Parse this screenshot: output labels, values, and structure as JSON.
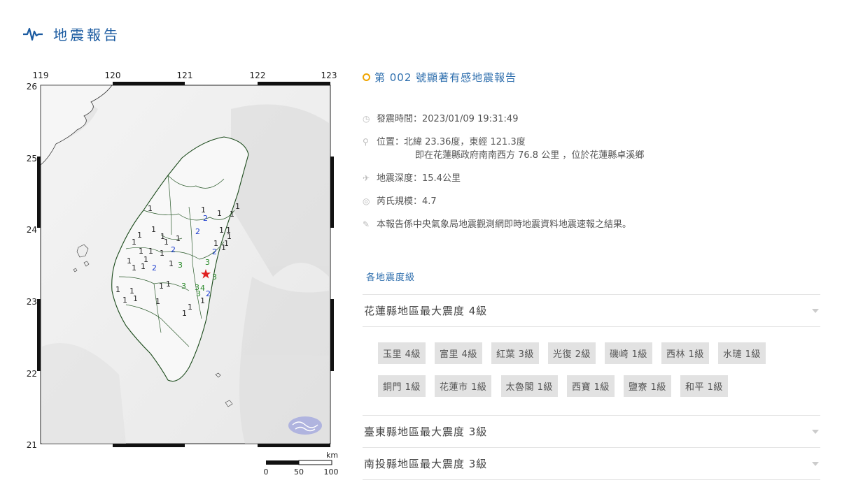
{
  "page": {
    "title": "地震報告"
  },
  "map": {
    "lon_ticks": [
      "119",
      "120",
      "121",
      "122",
      "123"
    ],
    "lat_ticks": [
      "26",
      "25",
      "24",
      "23",
      "22",
      "21"
    ],
    "scale_unit": "km",
    "scale_labels": [
      "0",
      "50",
      "100"
    ]
  },
  "report": {
    "title": "第 002 號顯著有感地震報告",
    "time_label": "發震時間：",
    "time": "2023/01/09 19:31:49",
    "location_label": "位置：",
    "location": "北緯 23.36度，東經 121.3度",
    "location_sub": "即在花蓮縣政府南南西方 76.8 公里 ，位於花蓮縣卓溪鄉",
    "depth_label": "地震深度：",
    "depth": "15.4公里",
    "magnitude_label": "芮氏規模：",
    "magnitude": "4.7",
    "note": "本報告係中央氣象局地震觀測網即時地震資料地震速報之結果。"
  },
  "intensity": {
    "section_label": "各地震度級",
    "counties": [
      {
        "title": "花蓮縣地區最大震度 4級",
        "stations": [
          "玉里 4級",
          "富里 4級",
          "紅葉 3級",
          "光復 2級",
          "磯崎 1級",
          "西林 1級",
          "水璉 1級",
          "銅門 1級",
          "花蓮市 1級",
          "太魯閣 1級",
          "西寶 1級",
          "鹽寮 1級",
          "和平 1級"
        ]
      },
      {
        "title": "臺東縣地區最大震度 3級"
      },
      {
        "title": "南投縣地區最大震度 3級"
      }
    ]
  },
  "colors": {
    "accent": "#2f6fae",
    "epicenter": "#e02020",
    "int1": "#222222",
    "int2": "#1f3fd0",
    "int3": "#2a8a2a"
  }
}
